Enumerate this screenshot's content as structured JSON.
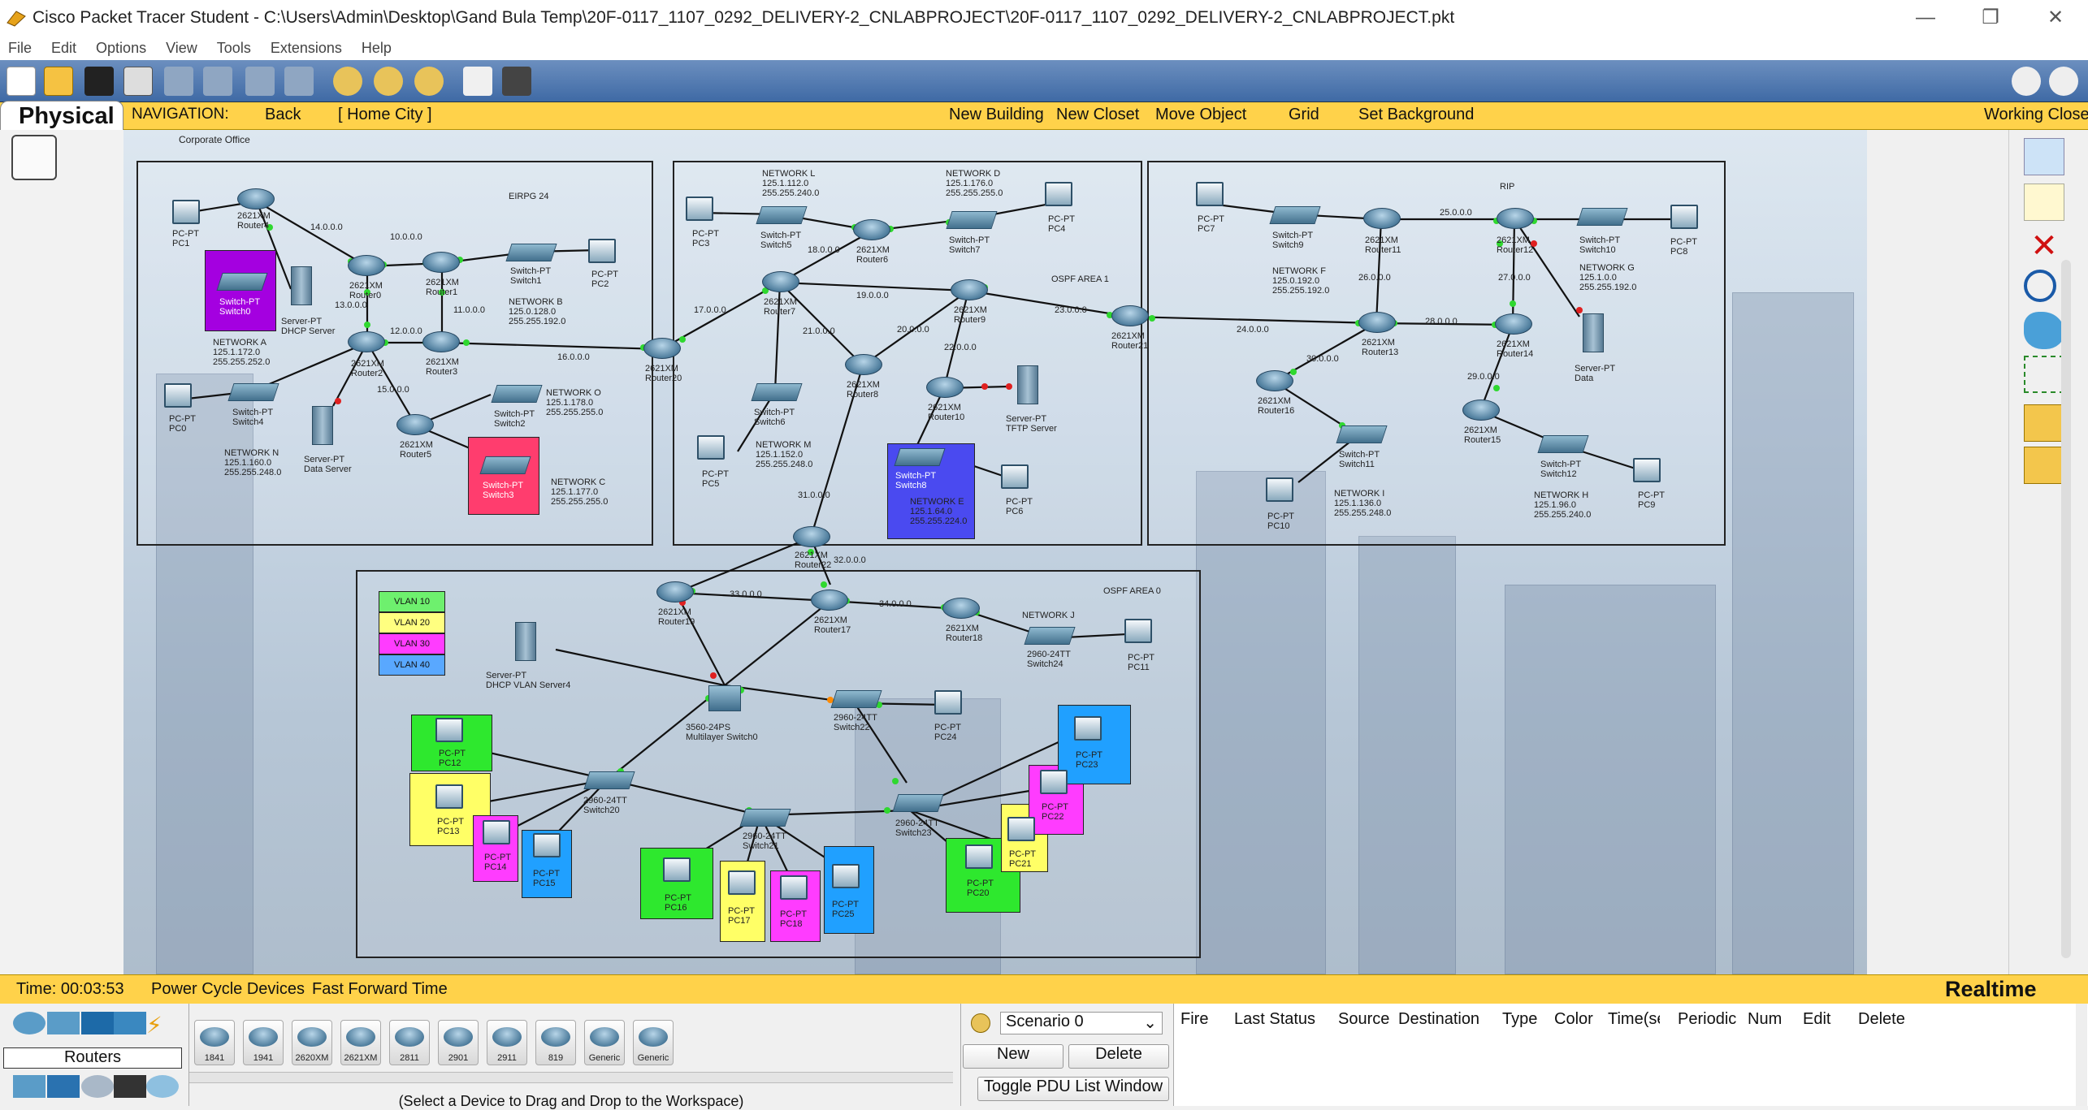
{
  "window": {
    "title": "Cisco Packet Tracer Student - C:\\Users\\Admin\\Desktop\\Gand Bula Temp\\20F-0117_1107_0292_DELIVERY-2_CNLABPROJECT\\20F-0117_1107_0292_DELIVERY-2_CNLABPROJECT.pkt",
    "minimize": "—",
    "maximize": "❐",
    "close": "✕"
  },
  "menu": [
    "File",
    "Edit",
    "Options",
    "View",
    "Tools",
    "Extensions",
    "Help"
  ],
  "navbar": {
    "tab": "Physical",
    "navigation": "NAVIGATION:",
    "back": "Back",
    "home": "[ Home City ]",
    "new_building": "New Building",
    "new_closet": "New Closet",
    "move_object": "Move Object",
    "grid": "Grid",
    "set_background": "Set Background",
    "working_closet": "Working Closet"
  },
  "workspace": {
    "corporate_office": "Corporate Office",
    "areas": {
      "eirpg": "EIRPG 24",
      "ospf1": "OSPF AREA 1",
      "rip": "RIP",
      "ospf0": "OSPF AREA 0"
    },
    "vlans": [
      "VLAN 10",
      "VLAN 20",
      "VLAN 30",
      "VLAN 40"
    ],
    "vlan_colors": [
      "#6ef06e",
      "#ffff80",
      "#ff3cff",
      "#59a8ff"
    ],
    "networks": {
      "a": "NETWORK A\n125.1.172.0\n255.255.252.0",
      "b": "NETWORK B\n125.0.128.0\n255.255.192.0",
      "n": "NETWORK N\n125.1.160.0\n255.255.248.0",
      "o": "NETWORK O\n125.1.178.0\n255.255.255.0",
      "c": "NETWORK C\n125.1.177.0\n255.255.255.0",
      "l": "NETWORK L\n125.1.112.0\n255.255.240.0",
      "d": "NETWORK D\n125.1.176.0\n255.255.255.0",
      "m": "NETWORK M\n125.1.152.0\n255.255.248.0",
      "e": "NETWORK E\n125.1.64.0\n255.255.224.0",
      "f": "NETWORK F\n125.0.192.0\n255.255.192.0",
      "g": "NETWORK G\n125.1.0.0\n255.255.192.0",
      "i": "NETWORK I\n125.1.136.0\n255.255.248.0",
      "h": "NETWORK H\n125.1.96.0\n255.255.240.0",
      "j": "NETWORK J"
    },
    "links": [
      "14.0.0.0",
      "10.0.0.0",
      "13.0.0.0",
      "11.0.0.0",
      "12.0.0.0",
      "15.0.0.0",
      "16.0.0.0",
      "17.0.0.0",
      "18.0.0.0",
      "19.0.0.0",
      "20.0.0.0",
      "21.0.0.0",
      "22.0.0.0",
      "23.0.0.0",
      "24.0.0.0",
      "25.0.0.0",
      "26.0.0.0",
      "27.0.0.0",
      "28.0.0.0",
      "29.0.0.0",
      "30.0.0.0",
      "31.0.0.0",
      "32.0.0.0",
      "33.0.0.0",
      "34.0.0.0"
    ],
    "devices": {
      "router4": "2621XM\nRouter4",
      "router0": "2621XM\nRouter0",
      "router1": "2621XM\nRouter1",
      "router2": "2621XM\nRouter2",
      "router3": "2621XM\nRouter3",
      "router5": "2621XM\nRouter5",
      "router20": "2621XM\nRouter20",
      "router6": "2621XM\nRouter6",
      "router7": "2621XM\nRouter7",
      "router9": "2621XM\nRouter9",
      "router8": "2621XM\nRouter8",
      "router10": "2621XM\nRouter10",
      "router21": "2621XM\nRouter21",
      "router11": "2621XM\nRouter11",
      "router12": "2621XM\nRouter12",
      "router13": "2621XM\nRouter13",
      "router14": "2621XM\nRouter14",
      "router16": "2621XM\nRouter16",
      "router15": "2621XM\nRouter15",
      "router22": "2621XM\nRouter22",
      "router19": "2621XM\nRouter19",
      "router17": "2621XM\nRouter17",
      "router18": "2621XM\nRouter18",
      "pc1": "PC-PT\nPC1",
      "pc0": "PC-PT\nPC0",
      "pc2": "PC-PT\nPC2",
      "pc3": "PC-PT\nPC3",
      "pc4": "PC-PT\nPC4",
      "pc5": "PC-PT\nPC5",
      "pc6": "PC-PT\nPC6",
      "pc7": "PC-PT\nPC7",
      "pc8": "PC-PT\nPC8",
      "pc9": "PC-PT\nPC9",
      "pc10": "PC-PT\nPC10",
      "pc11": "PC-PT\nPC11",
      "pc24": "PC-PT\nPC24",
      "pc12": "PC-PT\nPC12",
      "pc13": "PC-PT\nPC13",
      "pc14": "PC-PT\nPC14",
      "pc15": "PC-PT\nPC15",
      "pc16": "PC-PT\nPC16",
      "pc17": "PC-PT\nPC17",
      "pc18": "PC-PT\nPC18",
      "pc25": "PC-PT\nPC25",
      "pc20": "PC-PT\nPC20",
      "pc21": "PC-PT\nPC21",
      "pc22": "PC-PT\nPC22",
      "pc23": "PC-PT\nPC23",
      "switch0": "Switch-PT\nSwitch0",
      "switch1": "Switch-PT\nSwitch1",
      "switch4": "Switch-PT\nSwitch4",
      "switch2": "Switch-PT\nSwitch2",
      "switch3": "Switch-PT\nSwitch3",
      "switch5": "Switch-PT\nSwitch5",
      "switch7": "Switch-PT\nSwitch7",
      "switch6": "Switch-PT\nSwitch6",
      "switch8": "Switch-PT\nSwitch8",
      "switch9": "Switch-PT\nSwitch9",
      "switch10": "Switch-PT\nSwitch10",
      "switch11": "Switch-PT\nSwitch11",
      "switch12": "Switch-PT\nSwitch12",
      "switch24": "2960-24TT\nSwitch24",
      "switch22": "2960-24TT\nSwitch22",
      "switch20": "2960-24TT\nSwitch20",
      "switch21": "2960-24TT\nSwitch21",
      "switch23": "2960-24TT\nSwitch23",
      "mls0": "3560-24PS\nMultilayer Switch0",
      "dhcp": "Server-PT\nDHCP Server",
      "dataserver": "Server-PT\nData Server",
      "tftp": "Server-PT\nTFTP Server",
      "data": "Server-PT\nData",
      "dhcpvlan": "Server-PT\nDHCP VLAN Server4"
    }
  },
  "status": {
    "time": "Time: 00:03:53",
    "power_cycle": "Power Cycle Devices",
    "fast_forward": "Fast Forward Time",
    "mode": "Realtime"
  },
  "bottom": {
    "category": "Routers",
    "models": [
      "1841",
      "1941",
      "2620XM",
      "2621XM",
      "2811",
      "2901",
      "2911",
      "819",
      "Generic",
      "Generic"
    ],
    "hint": "(Select a Device to Drag and Drop to the Workspace)",
    "scenario": "Scenario 0",
    "new": "New",
    "delete": "Delete",
    "toggle_pdu": "Toggle PDU List Window",
    "pdu_columns": [
      "Fire",
      "Last Status",
      "Source",
      "Destination",
      "Type",
      "Color",
      "Time(sec)",
      "Periodic",
      "Num",
      "Edit",
      "Delete"
    ]
  }
}
